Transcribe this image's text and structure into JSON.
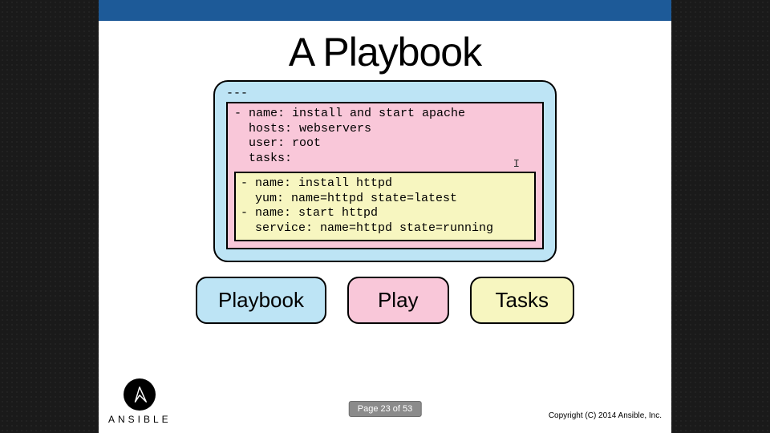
{
  "slide": {
    "title": "A Playbook",
    "copyright": "Copyright (C) 2014 Ansible, Inc.",
    "brand": "ANSIBLE"
  },
  "code": {
    "doc_start": "---",
    "play": {
      "l1": "- name: install and start apache",
      "l2": "  hosts: webservers",
      "l3": "  user: root",
      "l4": "",
      "l5": "  tasks:"
    },
    "tasks": {
      "t1": "- name: install httpd",
      "t2": "  yum: name=httpd state=latest",
      "t3": "",
      "t4": "- name: start httpd",
      "t5": "  service: name=httpd state=running"
    }
  },
  "legend": {
    "playbook": "Playbook",
    "play": "Play",
    "tasks": "Tasks"
  },
  "pager": {
    "label": "Page 23 of 53",
    "current": 23,
    "total": 53
  }
}
